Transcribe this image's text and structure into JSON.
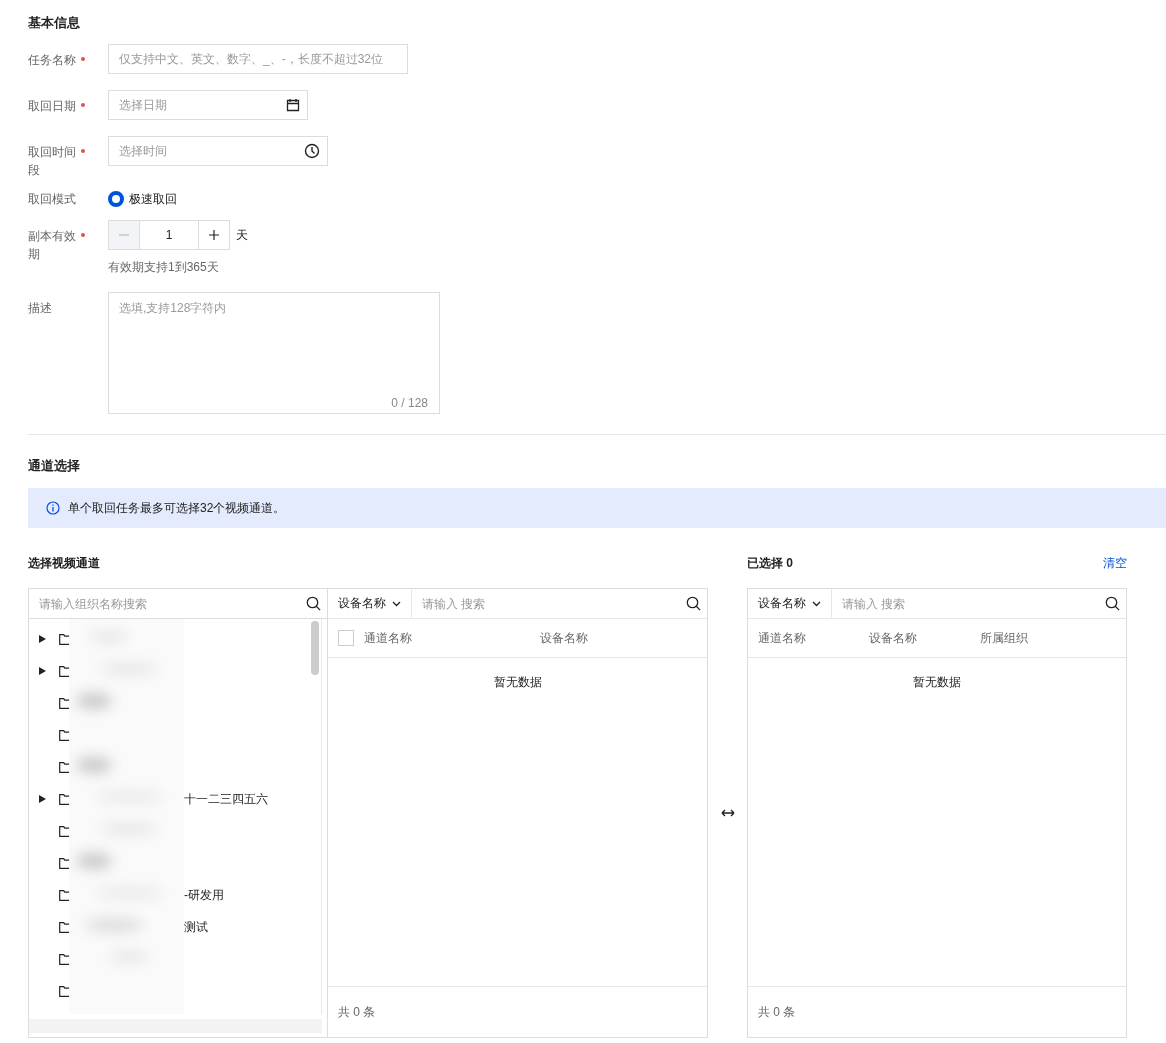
{
  "basic_info": {
    "title": "基本信息",
    "fields": [
      {
        "kind": "text",
        "label": "任务名称",
        "required": true,
        "placeholder": "仅支持中文、英文、数字、_、-，长度不超过32位"
      },
      {
        "kind": "date",
        "label": "取回日期",
        "required": true,
        "placeholder": "选择日期"
      },
      {
        "kind": "time",
        "label": "取回时间段",
        "required": true,
        "placeholder": "选择时间"
      },
      {
        "kind": "radio",
        "label": "取回模式",
        "required": false,
        "options": [
          {
            "label": "极速取回",
            "selected": true
          }
        ]
      },
      {
        "kind": "stepper",
        "label": "副本有效期",
        "required": true,
        "value": "1",
        "unit": "天",
        "minus_disabled": true,
        "hint": "有效期支持1到365天"
      },
      {
        "kind": "textarea",
        "label": "描述",
        "required": false,
        "placeholder": "选填,支持128字符内",
        "counter": "0 / 128"
      }
    ]
  },
  "channel_selection": {
    "title": "通道选择",
    "notice": "单个取回任务最多可选择32个视频通道。",
    "source": {
      "title": "选择视频通道",
      "tree_search_placeholder": "请输入组织名称搜索",
      "tree": [
        {
          "has_children": true
        },
        {
          "has_children": true
        },
        {
          "has_children": false
        },
        {
          "has_children": false
        },
        {
          "has_children": false
        },
        {
          "has_children": true,
          "label": "十一二三四五六"
        },
        {
          "has_children": false
        },
        {
          "has_children": false
        },
        {
          "has_children": false,
          "label": "-研发用"
        },
        {
          "has_children": false,
          "label": "测试"
        },
        {
          "has_children": false
        },
        {
          "has_children": false
        }
      ],
      "filter": "设备名称",
      "search_placeholder": "请输入 搜索",
      "columns": [
        "通道名称",
        "设备名称"
      ],
      "select_all_checked": false,
      "empty_text": "暂无数据",
      "total": "共 0 条"
    },
    "target": {
      "title": "已选择 0",
      "clear": "清空",
      "filter": "设备名称",
      "search_placeholder": "请输入 搜索",
      "columns": [
        "通道名称",
        "设备名称",
        "所属组织"
      ],
      "empty_text": "暂无数据",
      "total": "共 0 条"
    }
  }
}
